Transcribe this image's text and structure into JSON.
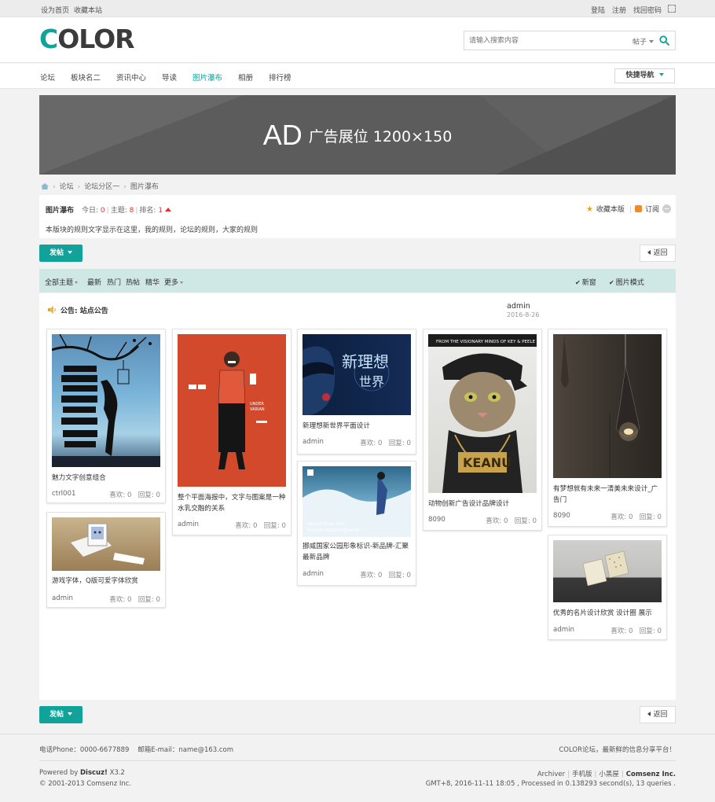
{
  "topbar": {
    "set_home": "设为首页",
    "bookmark": "收藏本站",
    "login": "登陆",
    "register": "注册",
    "forgot": "找回密码"
  },
  "header": {
    "logo_first": "C",
    "logo_rest": "OLOR",
    "search_placeholder": "请输入搜索内容",
    "search_scope": "帖子"
  },
  "nav": {
    "items": [
      "论坛",
      "板块名二",
      "资讯中心",
      "导读",
      "图片瀑布",
      "相册",
      "排行榜"
    ],
    "active_index": 4,
    "quick_nav": "快捷导航"
  },
  "ad": {
    "big": "AD",
    "small": "广告展位 1200×150"
  },
  "breadcrumb": [
    "论坛",
    "论坛分区一",
    "图片瀑布"
  ],
  "forum": {
    "name": "图片瀑布",
    "today_label": "今日:",
    "today_value": "0",
    "topics_label": "主题:",
    "topics_value": "8",
    "rank_label": "排名:",
    "rank_value": "1",
    "rules": "本版块的规则文字显示在这里，我的规则，论坛的规则，大家的规则",
    "favorite": "收藏本版",
    "subscribe": "订阅"
  },
  "buttons": {
    "post": "发帖",
    "back": "返回"
  },
  "filter": {
    "all": "全部主题",
    "latest": "最新",
    "hot": "热门",
    "hot_posts": "热帖",
    "digest": "精华",
    "more": "更多",
    "new_window": "新窗",
    "image_mode": "图片模式"
  },
  "notice": {
    "text": "公告: 站点公告",
    "author": "admin",
    "date": "2016-8-26"
  },
  "cards": [
    {
      "title": "魅力文字创意组合",
      "author": "ctrl001",
      "likes": "喜欢: 0",
      "replies": "回复: 0"
    },
    {
      "title": "游戏字体，Q版可爱字体欣赏",
      "author": "admin",
      "likes": "喜欢: 0",
      "replies": "回复: 0"
    },
    {
      "title": "整个平面海报中，文字与图案是一种水乳交融的关系",
      "author": "admin",
      "likes": "喜欢: 0",
      "replies": "回复: 0"
    },
    {
      "title": "新理想新世界平面设计",
      "author": "admin",
      "likes": "喜欢: 0",
      "replies": "回复: 0"
    },
    {
      "title": "挪威国家公园形象标识-新品牌-汇聚最新品牌",
      "author": "admin",
      "likes": "喜欢: 0",
      "replies": "回复: 0"
    },
    {
      "title": "动物创新广告设计品牌设计",
      "author": "8090",
      "likes": "喜欢: 0",
      "replies": "回复: 0"
    },
    {
      "title": "有梦想就有未来一清美未来设计_广告门",
      "author": "8090",
      "likes": "喜欢: 0",
      "replies": "回复: 0"
    },
    {
      "title": "优秀的名片设计欣赏 设计圈 展示",
      "author": "admin",
      "likes": "喜欢: 0",
      "replies": "回复: 0"
    }
  ],
  "footer": {
    "phone": "电话Phone：0000-6677889",
    "email": "邮箱E-mail：name@163.com",
    "slogan": "COLOR论坛，最新鲜的信息分享平台！",
    "powered_prefix": "Powered by ",
    "powered_name": "Discuz!",
    "powered_ver": " X3.2",
    "copyright": "© 2001-2013 Comsenz Inc.",
    "links": [
      "Archiver",
      "手机版",
      "小黑屋"
    ],
    "company": "Comsenz Inc.",
    "gmt": "GMT+8, 2016-11-11 18:05 , Processed in 0.138293 second(s), 13 queries ."
  },
  "colors": {
    "accent": "#11a29a",
    "filter_bg": "#cfe7e5",
    "ad_bg": "#5c5c5c"
  }
}
